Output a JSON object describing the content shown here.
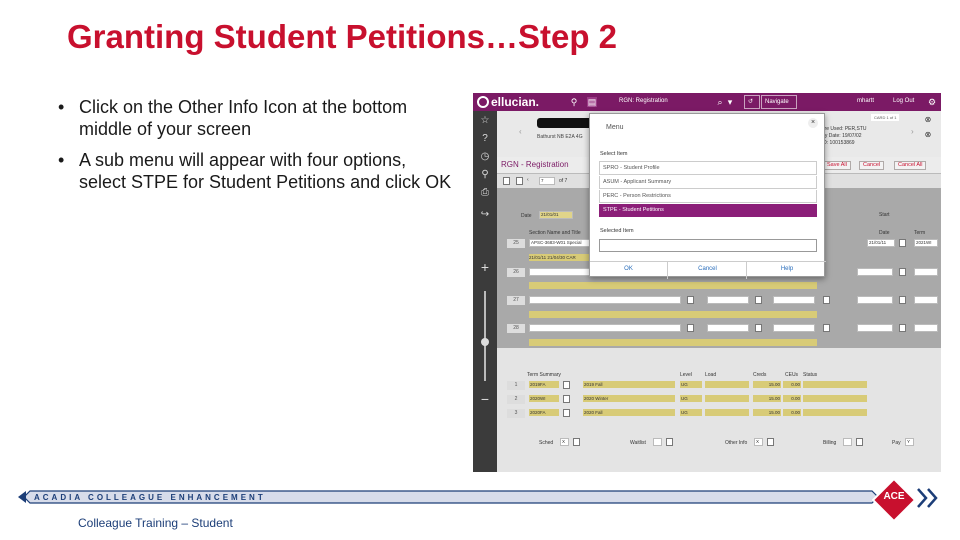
{
  "slide": {
    "title": "Granting Student Petitions…Step 2",
    "bullets": [
      "Click on the Other Info Icon at the bottom middle of your screen",
      "A sub menu will appear with four options, select STPE for Student Petitions and click OK"
    ],
    "footer_brand": "ACADIA COLLEAGUE ENHANCEMENT",
    "footer_caption": "Colleague Training – Student",
    "ace_logo": "ACE",
    "colors": {
      "title": "#c8102e",
      "accent": "#7b1a65",
      "footer": "#1c3e78"
    }
  },
  "app": {
    "brand": "ellucian.",
    "form_code": "RGN: Registration",
    "navigate_label": "Navigate",
    "user": "mhartt",
    "logout": "Log Out",
    "card_badge": "CARD 1 of 1",
    "form_title": "RGN - Registration",
    "address_partial": "Bathurst NB E2A 4G",
    "right_info": [
      "here Used: PER,STU",
      "ntry Date: 19/07/02",
      "t ID: 100153869"
    ],
    "actions": [
      "Save All",
      "Cancel",
      "Cancel All"
    ],
    "pager": {
      "page": "7",
      "of": "of 7"
    },
    "date_label": "Date",
    "date_value": "21/01/01",
    "start_label": "Start",
    "columns": {
      "section": "Section Name and Title",
      "date": "Date",
      "term": "Term"
    },
    "rows": [
      {
        "num": "25",
        "section": "APSC-3683-W01 Special",
        "date": "21/01/11",
        "term": "2021WI",
        "meeting": "21/01/11 21/04/30 CAR"
      },
      {
        "num": "26"
      },
      {
        "num": "27"
      },
      {
        "num": "28"
      }
    ],
    "term_summary": {
      "headers": [
        "Term Summary",
        "Level",
        "Load",
        "Creds",
        "CEUs",
        "Status"
      ],
      "rows": [
        {
          "num": "1",
          "term": "2019FA",
          "desc": "2019 Fall",
          "level": "UG",
          "creds": "15.00",
          "ceus": "0.00"
        },
        {
          "num": "2",
          "term": "2020WI",
          "desc": "2020 Winter",
          "level": "UG",
          "creds": "15.00",
          "ceus": "0.00"
        },
        {
          "num": "3",
          "term": "2020FA",
          "desc": "2020 Fall",
          "level": "UG",
          "creds": "15.00",
          "ceus": "0.00"
        }
      ]
    },
    "bottom_fields": [
      "Sched",
      "Waitlist",
      "Other Info",
      "Billing",
      "Pay"
    ],
    "bottom_values": {
      "sched": "X",
      "other_info": "X",
      "pay": "Y"
    }
  },
  "dialog": {
    "title": "Menu",
    "select_label": "Select Item",
    "options": [
      "SPRO - Student Profile",
      "ASUM - Applicant Summary",
      "PERC - Person Restrictions",
      "STPE - Student Petitions"
    ],
    "selected_index": 3,
    "selected_label": "Selected Item",
    "buttons": [
      "OK",
      "Cancel",
      "Help"
    ]
  }
}
